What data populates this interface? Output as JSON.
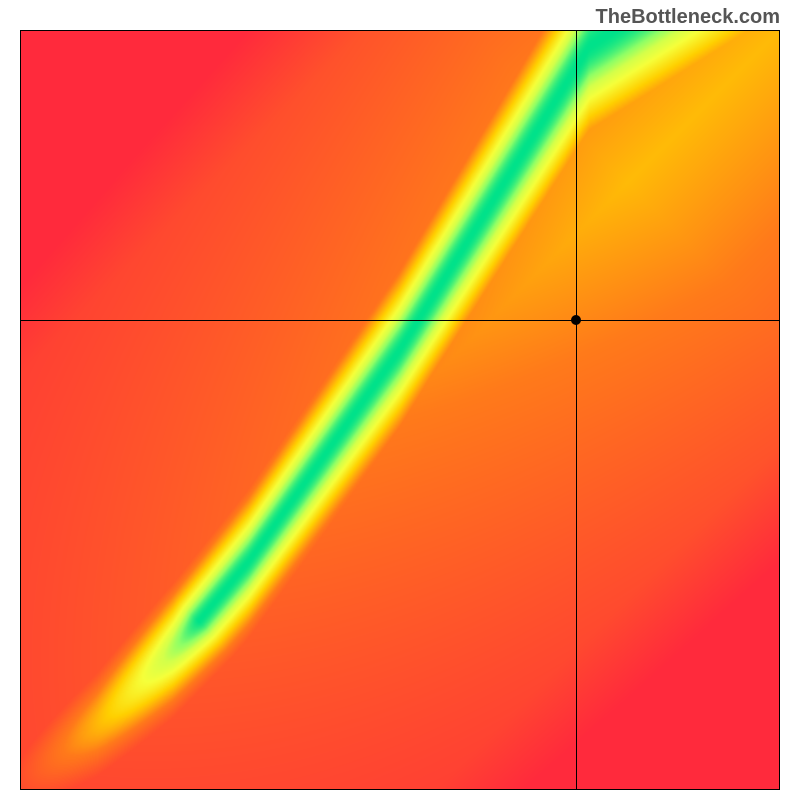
{
  "watermark": "TheBottleneck.com",
  "chart_data": {
    "type": "heatmap",
    "title": "",
    "xlabel": "",
    "ylabel": "",
    "xlim": [
      0,
      100
    ],
    "ylim": [
      0,
      100
    ],
    "marker": {
      "x": 73,
      "y": 62
    },
    "crosshair": {
      "x": 73,
      "y": 62
    },
    "colormap": {
      "stops": [
        {
          "t": 0.0,
          "color": "#ff2a3c"
        },
        {
          "t": 0.35,
          "color": "#ff7a1a"
        },
        {
          "t": 0.55,
          "color": "#ffd000"
        },
        {
          "t": 0.72,
          "color": "#f6ff3a"
        },
        {
          "t": 0.82,
          "color": "#d4ff4a"
        },
        {
          "t": 0.9,
          "color": "#8fff66"
        },
        {
          "t": 1.0,
          "color": "#00e28a"
        }
      ]
    },
    "ridge": [
      {
        "x": 0,
        "y": 0
      },
      {
        "x": 10,
        "y": 8
      },
      {
        "x": 20,
        "y": 18
      },
      {
        "x": 30,
        "y": 30
      },
      {
        "x": 40,
        "y": 44
      },
      {
        "x": 50,
        "y": 58
      },
      {
        "x": 55,
        "y": 66
      },
      {
        "x": 60,
        "y": 74
      },
      {
        "x": 65,
        "y": 82
      },
      {
        "x": 70,
        "y": 90
      },
      {
        "x": 75,
        "y": 98
      },
      {
        "x": 78,
        "y": 100
      }
    ],
    "ridge_width_base": 0.04,
    "ridge_width_gain": 0.06,
    "diagonal_gain": 0.5
  }
}
